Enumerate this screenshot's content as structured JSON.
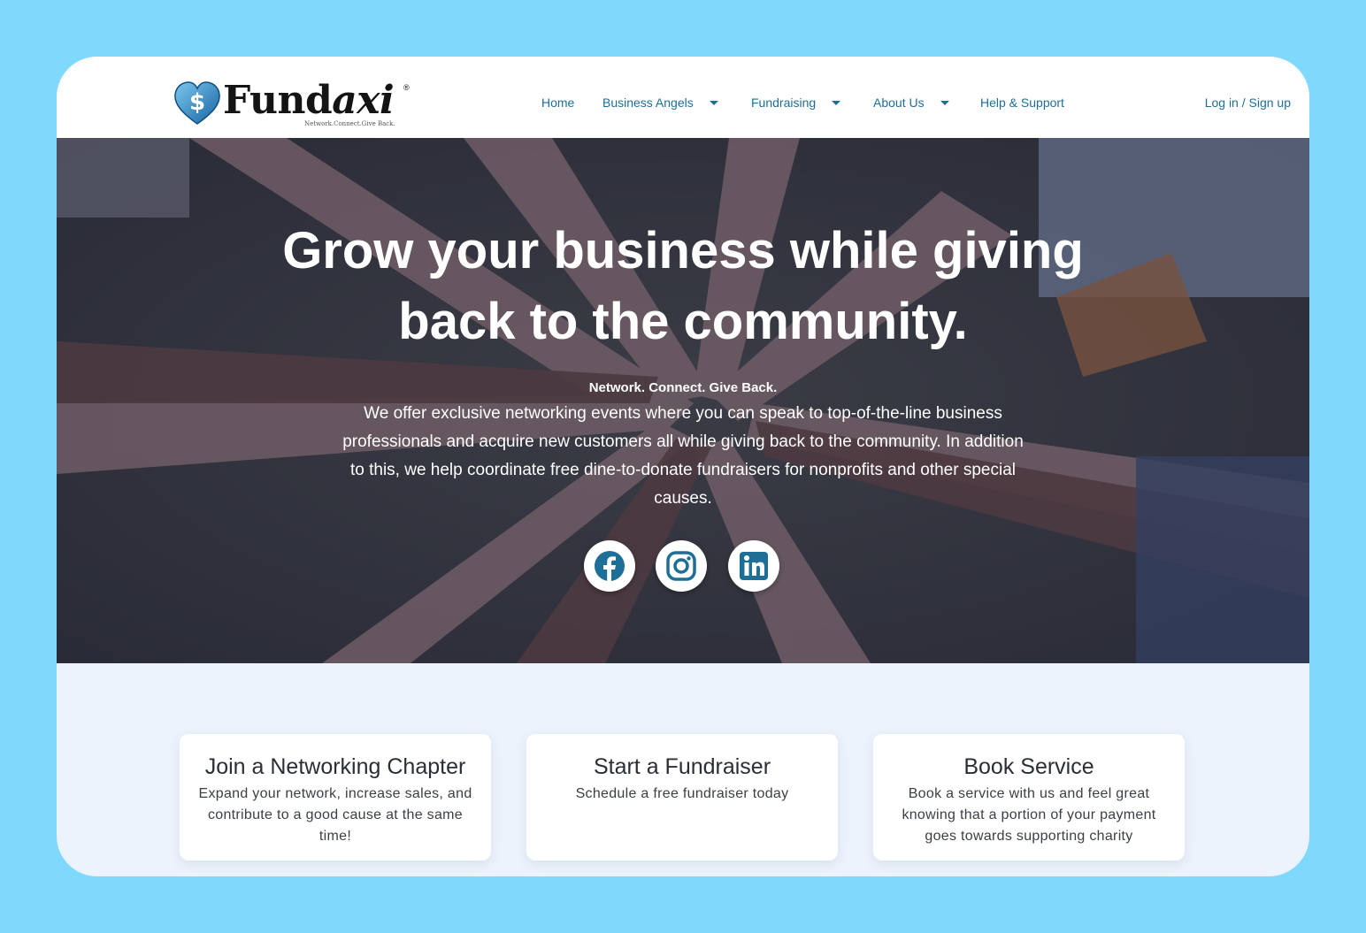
{
  "brand": {
    "name_plain": "Fund",
    "name_italic": "axi",
    "registered": "®",
    "tagline": "Network.Connect.Give Back."
  },
  "nav": {
    "items": [
      {
        "label": "Home"
      },
      {
        "label": "Business Angels"
      },
      {
        "label": "Fundraising"
      },
      {
        "label": "About Us"
      },
      {
        "label": "Help & Support"
      }
    ],
    "login": "Log in / Sign up"
  },
  "hero": {
    "title_line1": "Grow your business while giving",
    "title_line2": "back to the community.",
    "tagline": "Network. Connect. Give Back.",
    "body": "We offer exclusive networking events where you can speak to top-of-the-line business professionals and acquire new customers all while giving back to the community. In addition to this, we help coordinate free dine-to-donate fundraisers for nonprofits and other special causes.",
    "social": [
      {
        "icon": "facebook-icon"
      },
      {
        "icon": "instagram-icon"
      },
      {
        "icon": "linkedin-icon"
      }
    ]
  },
  "cards": [
    {
      "title": "Join a Networking Chapter",
      "description": "Expand your network, increase sales, and contribute to a good cause at the same time!"
    },
    {
      "title": "Start a Fundraiser",
      "description": "Schedule a free fundraiser today"
    },
    {
      "title": "Book Service",
      "description": "Book a service with us and feel great knowing that a portion of your payment goes towards supporting charity"
    }
  ],
  "colors": {
    "page_bg": "#7fd9fd",
    "nav_text": "#1d6f97",
    "social_icon": "#1d6f97",
    "cards_bg": "#edf3fc"
  }
}
